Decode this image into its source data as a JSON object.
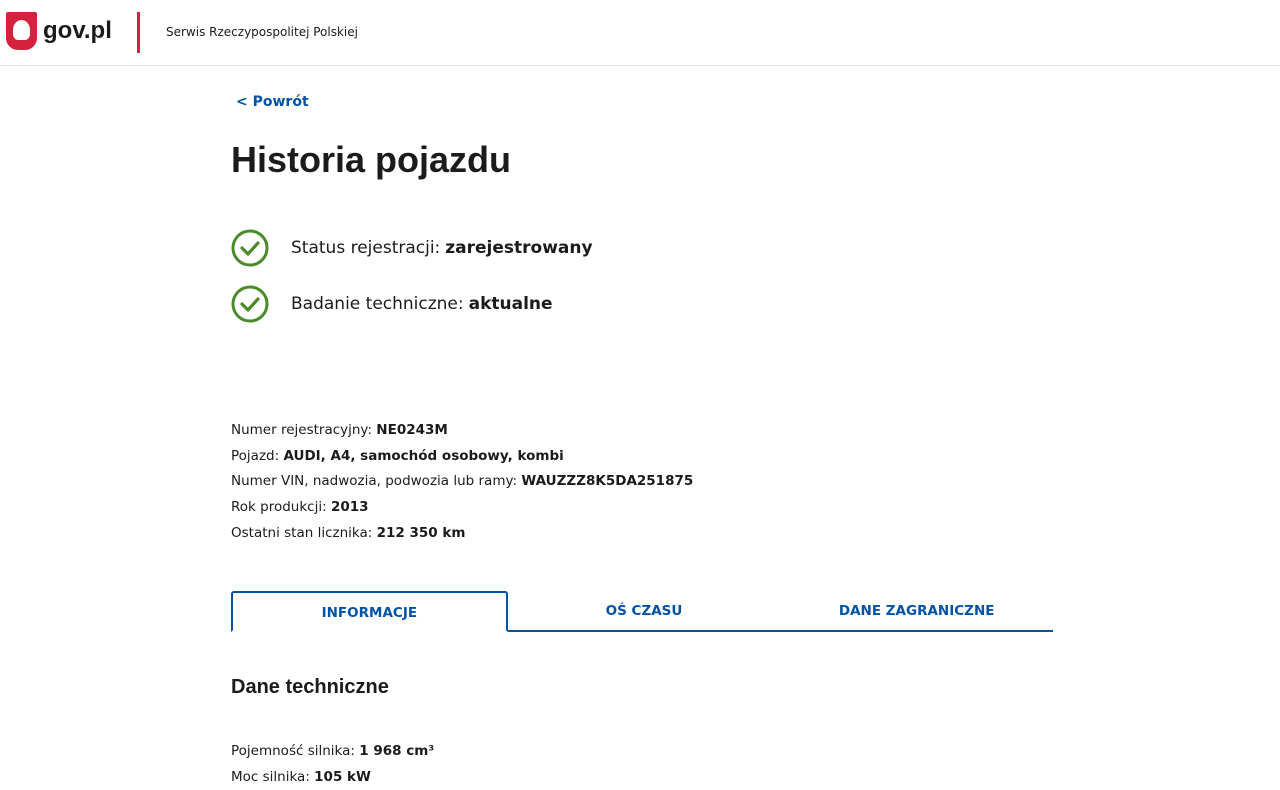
{
  "header": {
    "logo": "gov.pl",
    "service": "Serwis Rzeczypospolitej Polskiej"
  },
  "back": "< Powrót",
  "title": "Historia pojazdu",
  "status": [
    {
      "label": "Status rejestracji: ",
      "value": "zarejestrowany"
    },
    {
      "label": "Badanie techniczne: ",
      "value": "aktualne"
    }
  ],
  "vehicle": [
    {
      "label": "Numer rejestracyjny: ",
      "value": "NE0243M"
    },
    {
      "label": "Pojazd: ",
      "value": "AUDI, A4, samochód osobowy, kombi"
    },
    {
      "label": "Numer VIN, nadwozia, podwozia lub ramy: ",
      "value": "WAUZZZ8K5DA251875"
    },
    {
      "label": "Rok produkcji: ",
      "value": "2013"
    },
    {
      "label": "Ostatni stan licznika: ",
      "value": "212 350 km"
    }
  ],
  "tabs": [
    "INFORMACJE",
    "OŚ CZASU",
    "DANE ZAGRANICZNE"
  ],
  "section_title": "Dane techniczne",
  "tech": [
    {
      "label": "Pojemność silnika: ",
      "value": "1 968 cm³"
    },
    {
      "label": "Moc silnika: ",
      "value": "105 kW"
    }
  ],
  "colors": {
    "accent": "#0052a5",
    "ok": "#4a8a2a",
    "red": "#d4213d"
  }
}
